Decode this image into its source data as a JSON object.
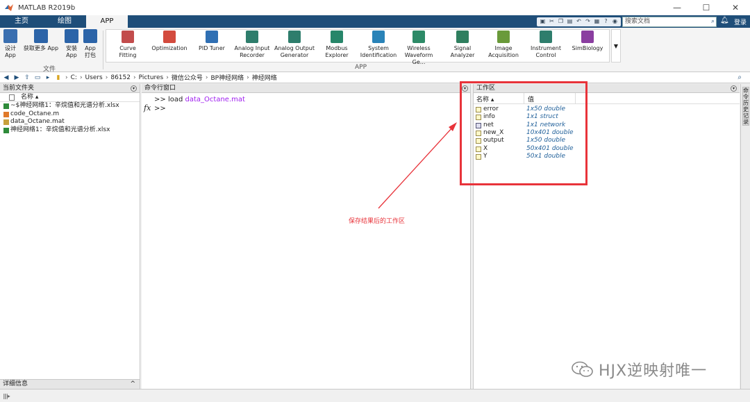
{
  "window": {
    "title": "MATLAB R2019b",
    "minimize": "—",
    "maximize": "☐",
    "close": "✕"
  },
  "tabs": [
    {
      "label": "主页"
    },
    {
      "label": "绘图"
    },
    {
      "label": "APP"
    }
  ],
  "search": {
    "placeholder": "搜索文档"
  },
  "login_label": "登录",
  "ribbon": {
    "file_group_label": "文件",
    "app_group_label": "APP",
    "file_buttons": [
      {
        "line1": "设计",
        "line2": "App",
        "color": "#3a6fb0"
      },
      {
        "line1": "获取更多 App",
        "line2": "",
        "color": "#2c64a8"
      },
      {
        "line1": "安装",
        "line2": "App",
        "color": "#2c64a8"
      },
      {
        "line1": "App",
        "line2": "打包",
        "color": "#2c64a8"
      }
    ],
    "apps": [
      {
        "line1": "Curve Fitting",
        "line2": "",
        "color": "#c24c4c"
      },
      {
        "line1": "Optimization",
        "line2": "",
        "color": "#d34b3e"
      },
      {
        "line1": "PID Tuner",
        "line2": "",
        "color": "#2f6fb3"
      },
      {
        "line1": "Analog Input",
        "line2": "Recorder",
        "color": "#2e7d6c"
      },
      {
        "line1": "Analog Output",
        "line2": "Generator",
        "color": "#2e7d6c"
      },
      {
        "line1": "Modbus",
        "line2": "Explorer",
        "color": "#27866a"
      },
      {
        "line1": "System",
        "line2": "Identification",
        "color": "#2a83b8"
      },
      {
        "line1": "Wireless",
        "line2": "Waveform Ge...",
        "color": "#2d8a67"
      },
      {
        "line1": "Signal Analyzer",
        "line2": "",
        "color": "#2f7f5f"
      },
      {
        "line1": "Image",
        "line2": "Acquisition",
        "color": "#6a9a3a"
      },
      {
        "line1": "Instrument",
        "line2": "Control",
        "color": "#2e7d6c"
      },
      {
        "line1": "SimBiology",
        "line2": "",
        "color": "#8a3ea0"
      }
    ],
    "more_arrow": "▼"
  },
  "path": {
    "crumbs": [
      "C:",
      "Users",
      "86152",
      "Pictures",
      "微信公众号",
      "BP神经网络",
      "神经网络"
    ],
    "separator": "›"
  },
  "current_folder": {
    "title": "当前文件夹",
    "name_header": "名称 ▴",
    "files": [
      {
        "name": "~$神经网络1：辛烷值和光谱分析.xlsx",
        "type": "xlsx"
      },
      {
        "name": "code_Octane.m",
        "type": "m"
      },
      {
        "name": "data_Octane.mat",
        "type": "mat"
      },
      {
        "name": "神经网络1：辛烷值和光谱分析.xlsx",
        "type": "xlsx"
      }
    ]
  },
  "details": {
    "title": "详细信息",
    "caret": "^"
  },
  "command_window": {
    "title": "命令行窗口",
    "prompt": ">>",
    "command": "load",
    "command_arg": "data_Octane.mat",
    "fx": "fx"
  },
  "workspace": {
    "title": "工作区",
    "name_header": "名称 ▴",
    "value_header": "值",
    "variables": [
      {
        "name": "error",
        "value": "1x50 double",
        "kind": "matrix"
      },
      {
        "name": "info",
        "value": "1x1 struct",
        "kind": "matrix"
      },
      {
        "name": "net",
        "value": "1x1 network",
        "kind": "object"
      },
      {
        "name": "new_X",
        "value": "10x401 double",
        "kind": "matrix"
      },
      {
        "name": "output",
        "value": "1x50 double",
        "kind": "matrix"
      },
      {
        "name": "X",
        "value": "50x401 double",
        "kind": "matrix"
      },
      {
        "name": "Y",
        "value": "50x1 double",
        "kind": "matrix"
      }
    ]
  },
  "right_strip_label": "命令历史记录",
  "annotation": {
    "text": "保存结果后的工作区",
    "color": "#e8333a"
  },
  "watermark": "HJX逆映射唯一",
  "colors": {
    "tab_bar": "#1f4e79",
    "string_arg": "#a020f0",
    "ws_value": "#1f5f99"
  }
}
